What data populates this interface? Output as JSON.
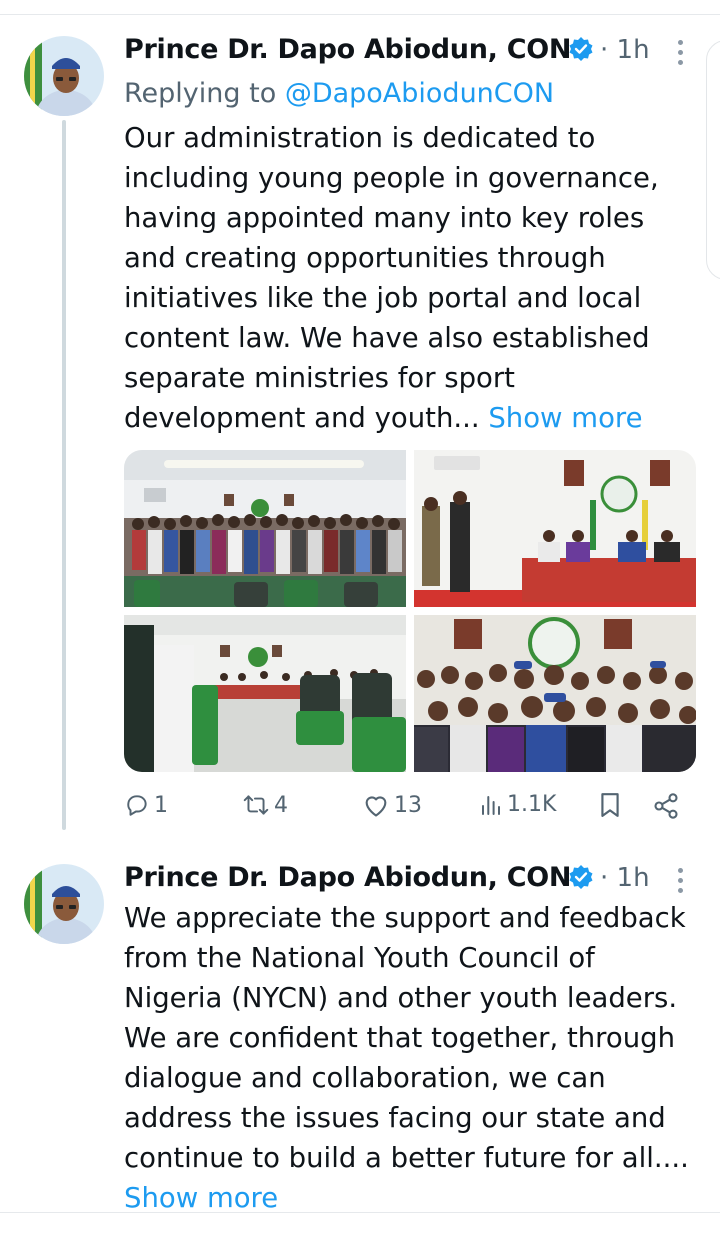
{
  "tweets": [
    {
      "author": "Prince Dr. Dapo Abiodun, CON",
      "time": "· 1h",
      "reply_prefix": "Replying to",
      "reply_handle": "@DapoAbiodunCON",
      "text_lines": [
        "Our administration is dedicated to",
        "including young people in governance,",
        "having appointed many into key roles",
        "and creating opportunities through",
        "initiatives like the job portal and local",
        "content law. We have also established",
        "separate ministries for sport",
        "development and youth..."
      ],
      "show_more": "Show more",
      "stats": {
        "replies": "1",
        "reposts": "4",
        "likes": "13",
        "views": "1.1K"
      }
    },
    {
      "author": "Prince Dr. Dapo Abiodun, CON",
      "time": "· 1h",
      "text_lines": [
        "We appreciate the support and feedback",
        "from the National Youth Council of",
        "Nigeria (NYCN) and other youth leaders.",
        "We are confident that together, through",
        "dialogue and collaboration, we can",
        "address the issues facing our state and",
        "continue to build a better future for all...."
      ],
      "show_more": "Show more"
    }
  ],
  "icons": {
    "verified": "verified-badge-icon",
    "more": "more-vertical-icon",
    "reply": "reply-icon",
    "repost": "repost-icon",
    "like": "heart-icon",
    "views": "views-icon",
    "bookmark": "bookmark-icon",
    "share": "share-icon"
  },
  "colors": {
    "link": "#1d9bf0",
    "secondary_text": "#536471",
    "thread_line": "#cfd9de"
  }
}
